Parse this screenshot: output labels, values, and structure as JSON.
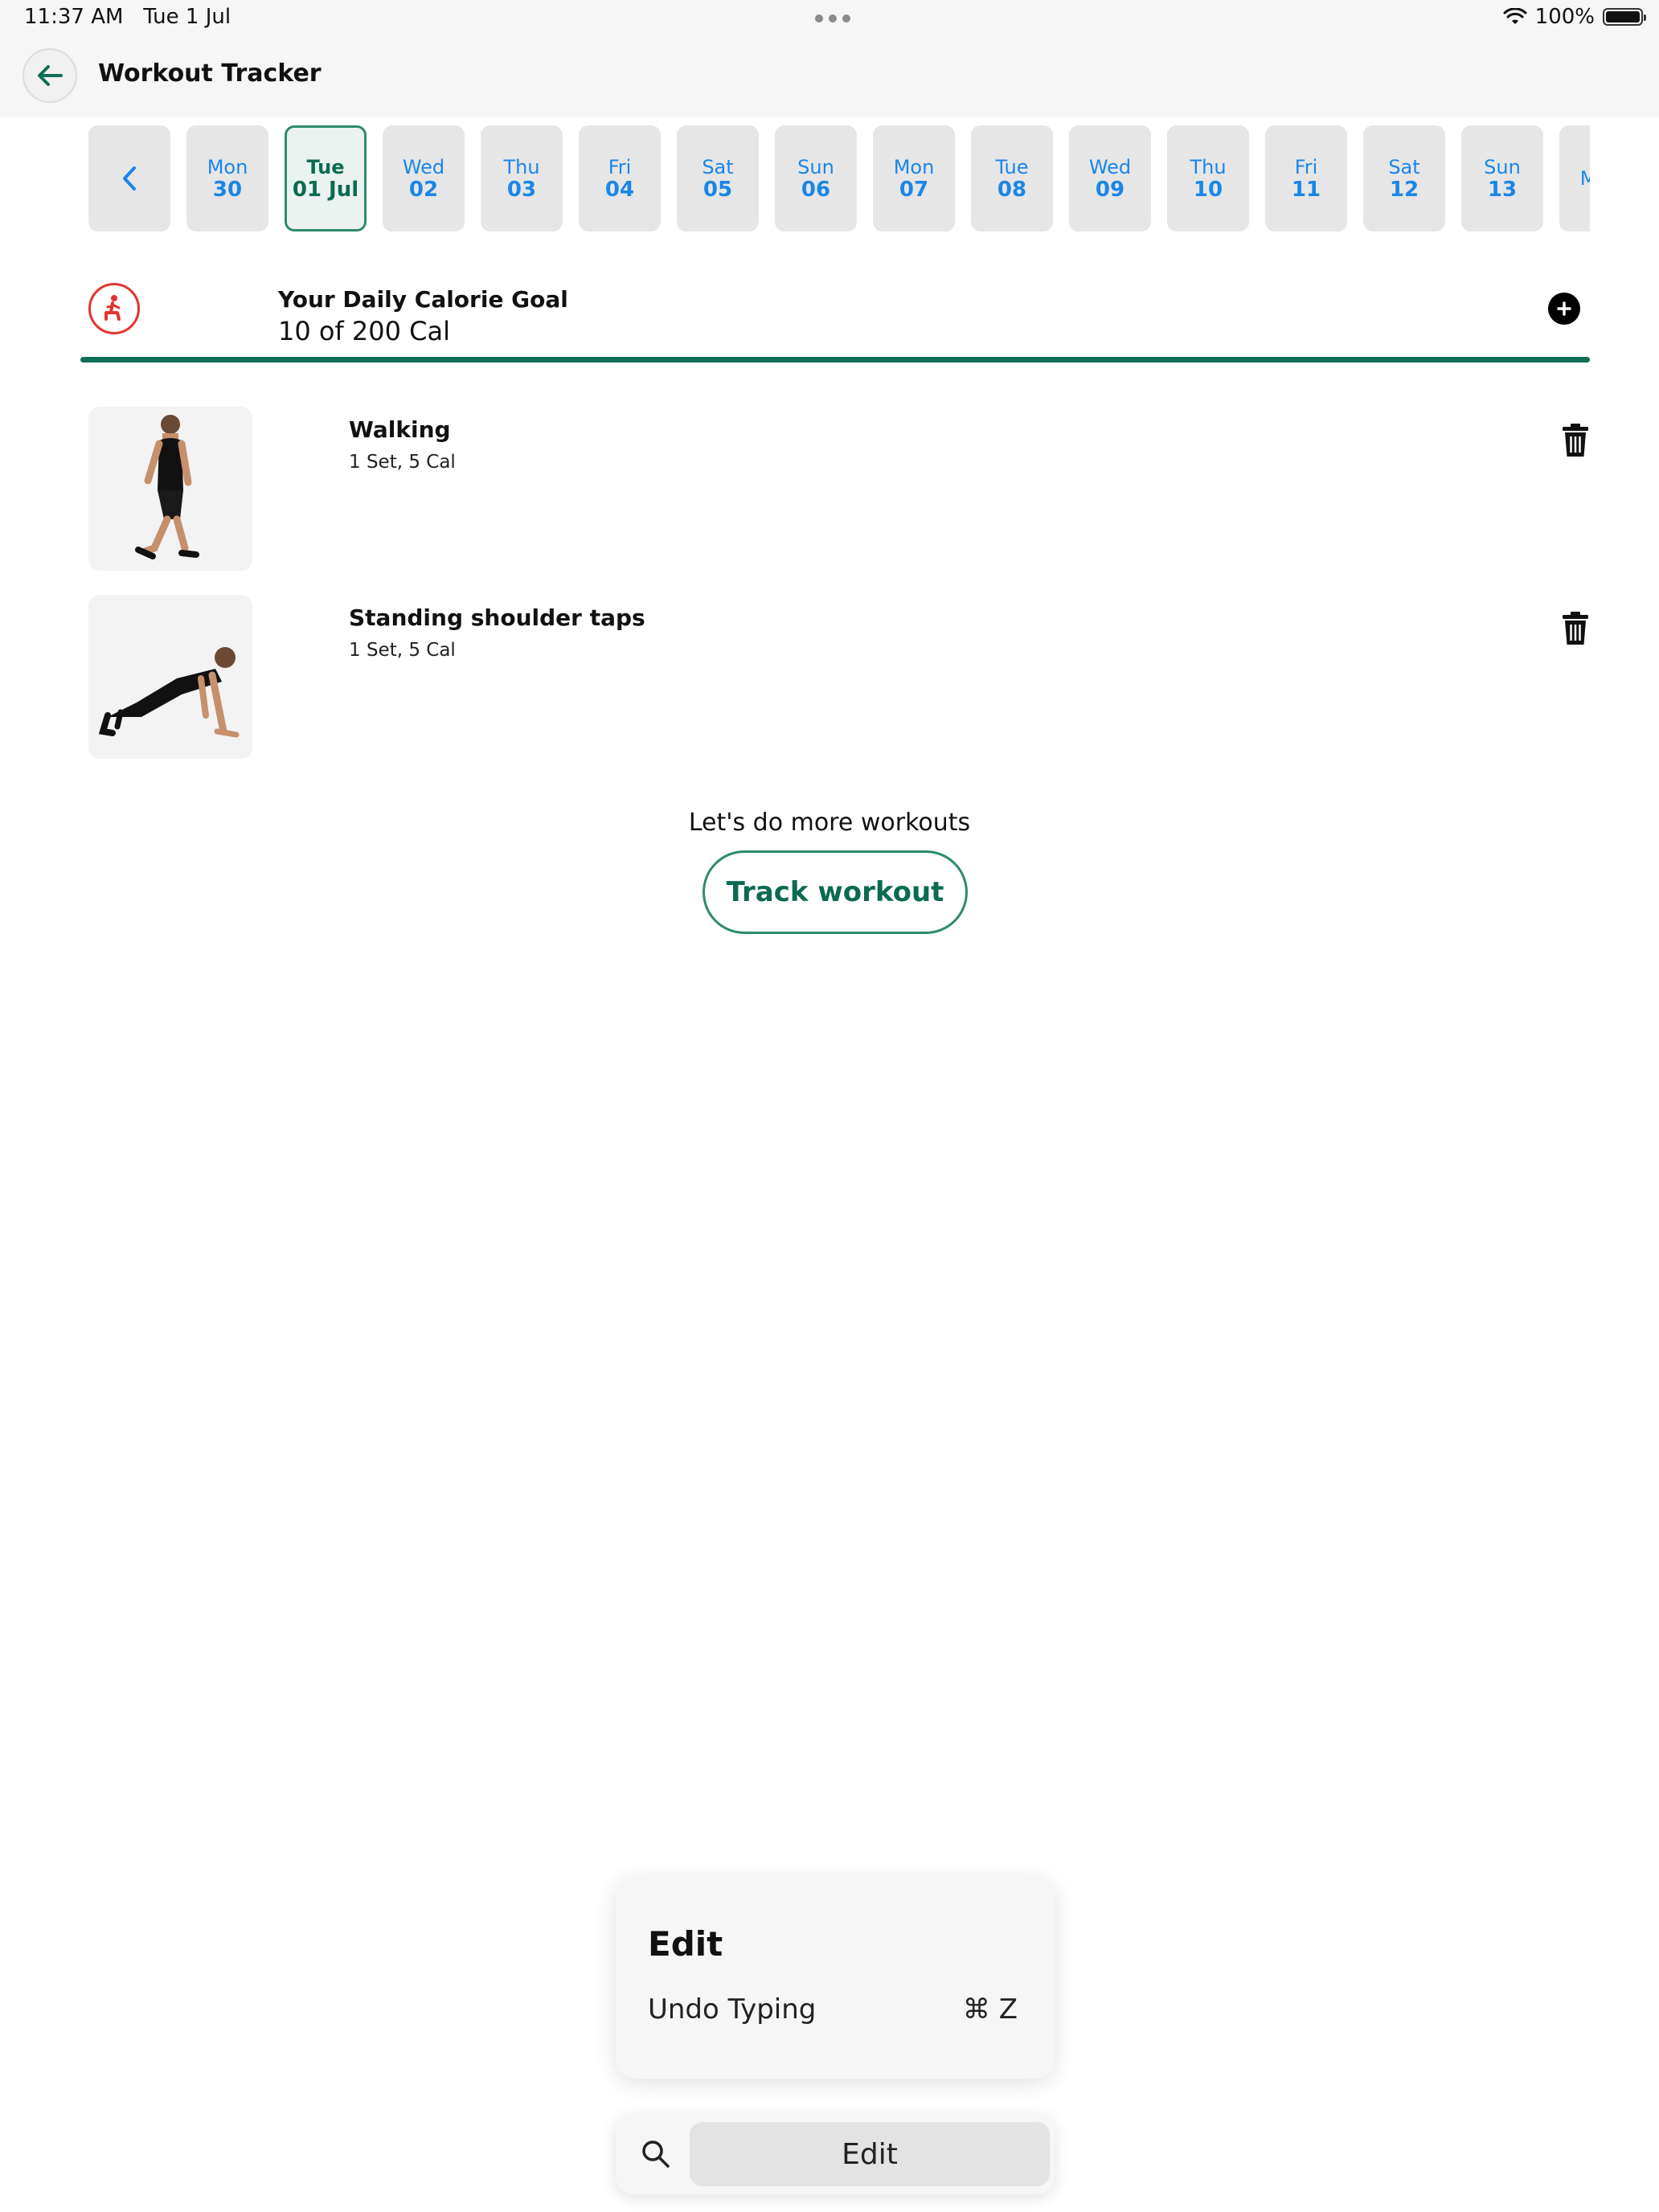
{
  "status_bar": {
    "time": "11:37 AM",
    "date": "Tue 1 Jul",
    "battery": "100%"
  },
  "header": {
    "title": "Workout Tracker"
  },
  "date_strip": {
    "days": [
      {
        "day": "Mon",
        "num": "30"
      },
      {
        "day": "Tue",
        "num": "01 Jul",
        "selected": true
      },
      {
        "day": "Wed",
        "num": "02"
      },
      {
        "day": "Thu",
        "num": "03"
      },
      {
        "day": "Fri",
        "num": "04"
      },
      {
        "day": "Sat",
        "num": "05"
      },
      {
        "day": "Sun",
        "num": "06"
      },
      {
        "day": "Mon",
        "num": "07"
      },
      {
        "day": "Tue",
        "num": "08"
      },
      {
        "day": "Wed",
        "num": "09"
      },
      {
        "day": "Thu",
        "num": "10"
      },
      {
        "day": "Fri",
        "num": "11"
      },
      {
        "day": "Sat",
        "num": "12"
      },
      {
        "day": "Sun",
        "num": "13"
      },
      {
        "day": "Mon",
        "num": ""
      }
    ]
  },
  "calorie_goal": {
    "title": "Your Daily Calorie Goal",
    "value": "10 of 200 Cal",
    "progress_fraction": 1.0
  },
  "workouts": [
    {
      "name": "Walking",
      "meta": "1 Set, 5 Cal"
    },
    {
      "name": "Standing shoulder taps",
      "meta": "1 Set, 5 Cal"
    }
  ],
  "cta": {
    "text": "Let's do more workouts",
    "button": "Track workout"
  },
  "edit_menu": {
    "title": "Edit",
    "item": "Undo Typing",
    "shortcut": "⌘ Z"
  },
  "search_bar": {
    "label": "Edit"
  },
  "colors": {
    "accent": "#106f57",
    "link_blue": "#1a86e8",
    "goal_red": "#e2342f"
  }
}
